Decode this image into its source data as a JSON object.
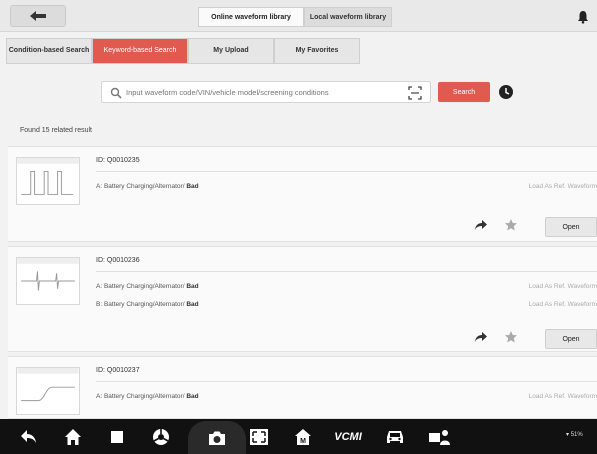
{
  "header": {
    "tabs": [
      {
        "label": "Online waveform library",
        "active": true
      },
      {
        "label": "Local waveform library",
        "active": false
      }
    ]
  },
  "subtabs": [
    {
      "label": "Condition-based Search",
      "active": false
    },
    {
      "label": "Keyword-based Search",
      "active": true
    },
    {
      "label": "My Upload",
      "active": false
    },
    {
      "label": "My Favorites",
      "active": false
    }
  ],
  "search": {
    "placeholder": "Input waveform code/VIN/vehicle model/screening conditions",
    "button_label": "Search"
  },
  "results_count_text": "Found 15 related result",
  "results": [
    {
      "id": "ID: Q0010235",
      "rows": [
        {
          "prefix": "A: Battery Charging/Alternator/",
          "status": "Bad",
          "action": "Load As Ref. Waveform"
        }
      ],
      "open_label": "Open"
    },
    {
      "id": "ID: Q0010236",
      "rows": [
        {
          "prefix": "A: Battery Charging/Alternator/",
          "status": "Bad",
          "action": "Load As Ref. Waveform"
        },
        {
          "prefix": "B: Battery Charging/Alternator/",
          "status": "Bad",
          "action": "Load As Ref. Waveform"
        }
      ],
      "open_label": "Open"
    },
    {
      "id": "ID: Q0010237",
      "rows": [
        {
          "prefix": "A: Battery Charging/Alternator/",
          "status": "Bad",
          "action": "Load As Ref. Waveform"
        }
      ],
      "open_label": "Open"
    }
  ],
  "bottom_nav": {
    "items": [
      "back-icon",
      "home-icon",
      "recent-apps-icon",
      "browser-icon",
      "camera-icon",
      "screen-record-icon",
      "maxifix-icon",
      "vcmi-icon",
      "car-icon",
      "remote-support-icon"
    ],
    "vcmi_label": "VCMI",
    "status_text": "51%"
  },
  "colors": {
    "accent": "#e05a4f",
    "topbar": "#e9e9e9",
    "navbar": "#111111"
  }
}
